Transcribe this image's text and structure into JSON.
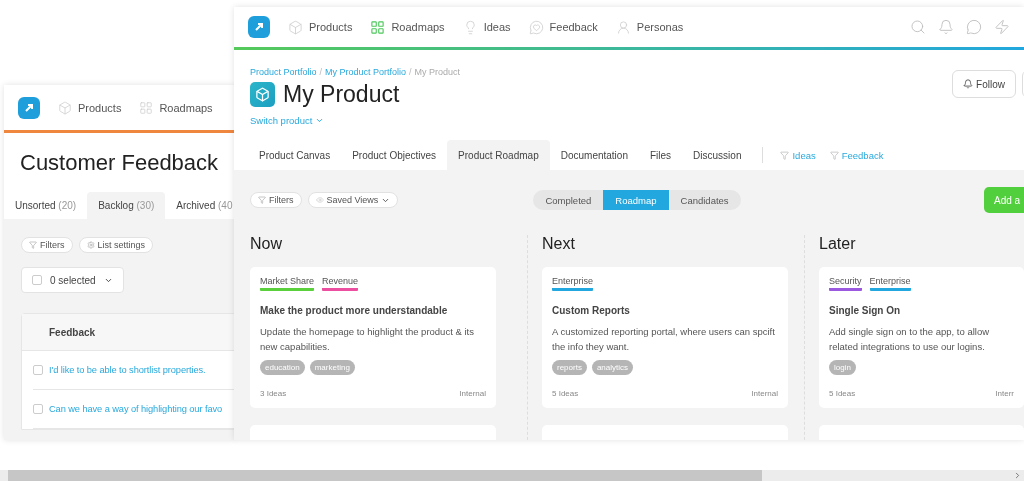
{
  "back_window": {
    "nav": [
      {
        "label": "Products"
      },
      {
        "label": "Roadmaps"
      }
    ],
    "title": "Customer Feedback",
    "tabs": [
      {
        "label": "Unsorted",
        "count": "(20)",
        "selected": false
      },
      {
        "label": "Backlog",
        "count": "(30)",
        "selected": true
      },
      {
        "label": "Archived",
        "count": "(40",
        "selected": false
      }
    ],
    "filters": "Filters",
    "list_settings": "List settings",
    "selection": {
      "label": "0 selected",
      "checked": false
    },
    "table": {
      "columns": [
        "Feedback"
      ],
      "rows": [
        {
          "text": "I'd like to be able to shortlist properties.",
          "checked": false
        },
        {
          "text": "Can we have a way of highlighting our favo",
          "checked": false
        }
      ]
    }
  },
  "front_window": {
    "nav": [
      {
        "label": "Products",
        "active": false
      },
      {
        "label": "Roadmaps",
        "active": true
      },
      {
        "label": "Ideas",
        "active": false
      },
      {
        "label": "Feedback",
        "active": false
      },
      {
        "label": "Personas",
        "active": false
      }
    ],
    "breadcrumb": [
      {
        "label": "Product Portfolio",
        "link": true
      },
      {
        "separator": "/",
        "label": "My Product Portfolio",
        "link": true
      },
      {
        "separator": "/",
        "label": "My Product",
        "link": false
      }
    ],
    "title": "My Product",
    "switch_product": "Switch product",
    "follow": "Follow",
    "tabs": [
      {
        "label": "Product Canvas",
        "selected": false
      },
      {
        "label": "Product Objectives",
        "selected": false
      },
      {
        "label": "Product Roadmap",
        "selected": true
      },
      {
        "label": "Documentation",
        "selected": false
      },
      {
        "label": "Files",
        "selected": false
      },
      {
        "label": "Discussion",
        "selected": false
      }
    ],
    "filter_links": [
      {
        "label": "Ideas"
      },
      {
        "label": "Feedback"
      }
    ],
    "filters": "Filters",
    "saved_views": "Saved Views",
    "views": [
      {
        "label": "Completed",
        "selected": false
      },
      {
        "label": "Roadmap",
        "selected": true
      },
      {
        "label": "Candidates",
        "selected": false
      }
    ],
    "add_button": "Add a",
    "columns": [
      {
        "title": "Now",
        "cards": [
          {
            "goals": [
              {
                "label": "Market Share",
                "color": "#5ad13c"
              },
              {
                "label": "Revenue",
                "color": "#ec4fa0"
              }
            ],
            "title": "Make the product more understandable",
            "description": "Update the homepage to highlight the product & its new capabilities.",
            "tags": [
              "education",
              "marketing"
            ],
            "ideas": "3 Ideas",
            "visibility": "Internal"
          }
        ]
      },
      {
        "title": "Next",
        "cards": [
          {
            "goals": [
              {
                "label": "Enterprise",
                "color": "#22a7de"
              }
            ],
            "title": "Custom Reports",
            "description": "A customized reporting portal, where users can spcift the info they want.",
            "tags": [
              "reports",
              "analytics"
            ],
            "ideas": "5 Ideas",
            "visibility": "Internal"
          }
        ]
      },
      {
        "title": "Later",
        "cards": [
          {
            "goals": [
              {
                "label": "Security",
                "color": "#9b59e0"
              },
              {
                "label": "Enterprise",
                "color": "#22a7de"
              }
            ],
            "title": "Single Sign On",
            "description": "Add single sign on to the app, to allow related integrations to use our logins.",
            "tags": [
              "login"
            ],
            "ideas": "5 Ideas",
            "visibility": "Interr"
          }
        ]
      }
    ]
  }
}
